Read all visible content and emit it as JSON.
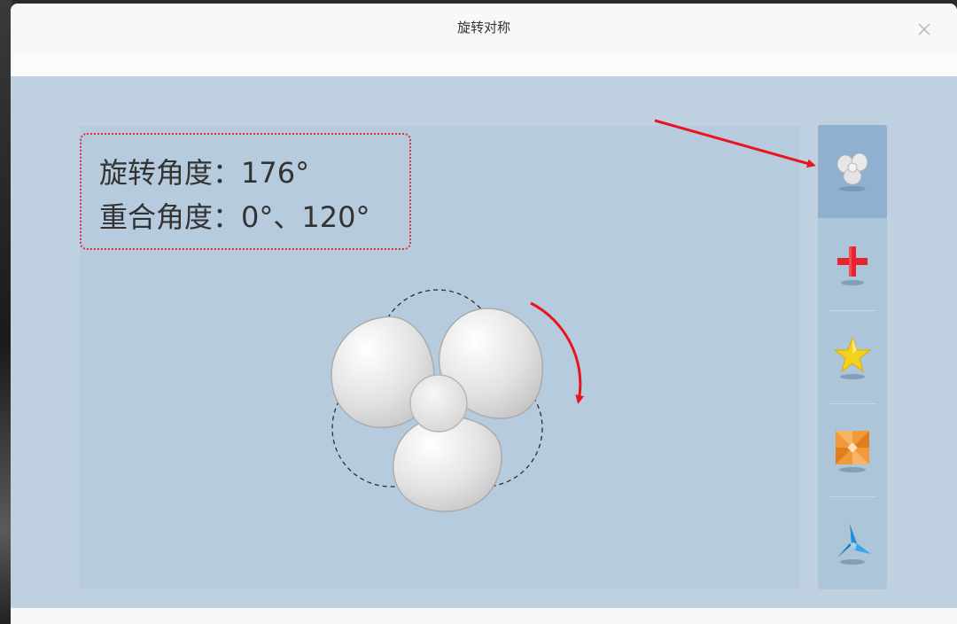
{
  "window": {
    "title": "旋转对称"
  },
  "info": {
    "rotation_label": "旋转角度：176°",
    "overlap_label": "重合角度：0°、120°"
  },
  "fan": {
    "rotation_deg": 176,
    "overlap_angles_deg": [
      0,
      120
    ]
  },
  "shapes": [
    {
      "name": "fan",
      "icon": "fan-icon",
      "selected": true
    },
    {
      "name": "cross",
      "icon": "red-cross-icon",
      "selected": false
    },
    {
      "name": "star",
      "icon": "yellow-star-icon",
      "selected": false
    },
    {
      "name": "pinwheel",
      "icon": "orange-pinwheel-icon",
      "selected": false
    },
    {
      "name": "tri-blade",
      "icon": "blue-triblade-icon",
      "selected": false
    }
  ],
  "colors": {
    "annotation_red": "#e0313a",
    "content_bg": "#bfd1e0",
    "stage_bg": "#b6cbdd",
    "selected_bg": "#8fb1cf"
  }
}
